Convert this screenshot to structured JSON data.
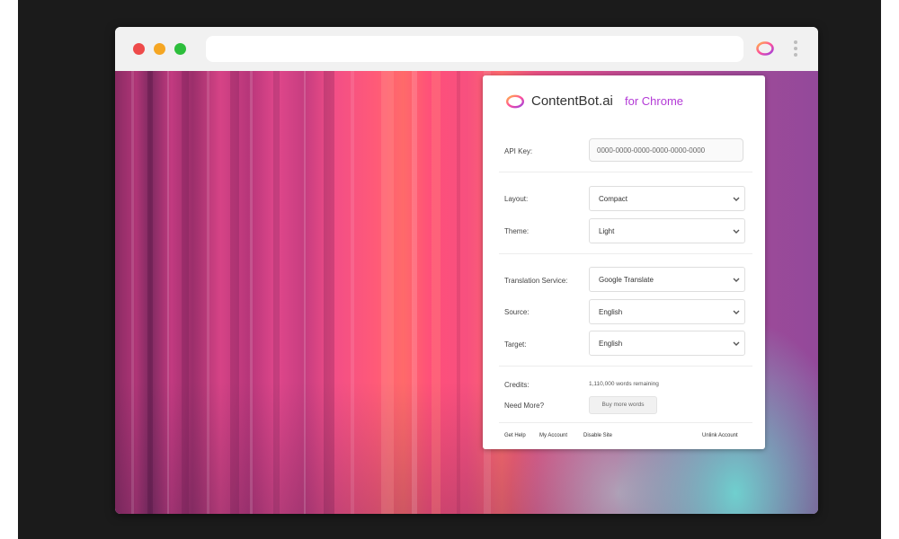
{
  "browser": {
    "address_value": ""
  },
  "extension": {
    "brand_name": "ContentBot.ai",
    "brand_sub": "for Chrome",
    "brand_color": "#b33ad6"
  },
  "form": {
    "api_key": {
      "label": "API Key:",
      "value": "0000-0000-0000-0000-0000-0000"
    },
    "layout": {
      "label": "Layout:",
      "value": "Compact"
    },
    "theme": {
      "label": "Theme:",
      "value": "Light"
    },
    "translation_service": {
      "label": "Translation Service:",
      "value": "Google Translate"
    },
    "source": {
      "label": "Source:",
      "value": "English"
    },
    "target": {
      "label": "Target:",
      "value": "English"
    },
    "credits": {
      "label": "Credits:",
      "value": "1,110,000 words remaining"
    },
    "need_more": {
      "label": "Need More?",
      "button": "Buy more words"
    }
  },
  "footer": {
    "get_help": "Get Help",
    "my_account": "My Account",
    "disable_site": "Disable Site",
    "unlink_account": "Unlink Account"
  },
  "colors": {
    "close": "#ee4a4a",
    "minimize": "#f5a623",
    "maximize": "#2dbe3c"
  }
}
